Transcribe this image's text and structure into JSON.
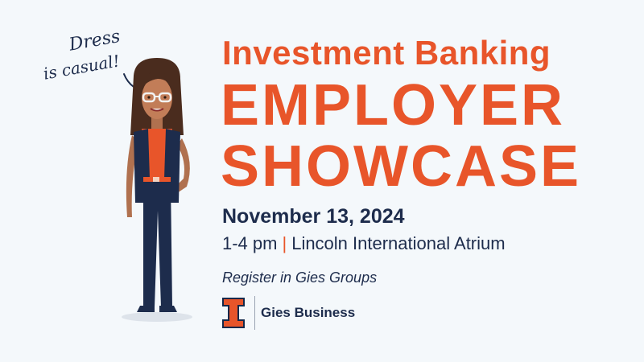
{
  "bubble": {
    "line1": "Dress",
    "line2": "is casual!"
  },
  "headline": {
    "line1": "Investment Banking",
    "line2": "EMPLOYER",
    "line3": "SHOWCASE"
  },
  "event": {
    "date": "November 13, 2024",
    "time": "1-4 pm",
    "separator": "|",
    "location": "Lincoln International Atrium",
    "register": "Register in Gies Groups"
  },
  "brand": {
    "name": "Gies Business"
  },
  "colors": {
    "orange": "#e8552a",
    "navy": "#1d2c4c",
    "background": "#f4f8fb"
  }
}
